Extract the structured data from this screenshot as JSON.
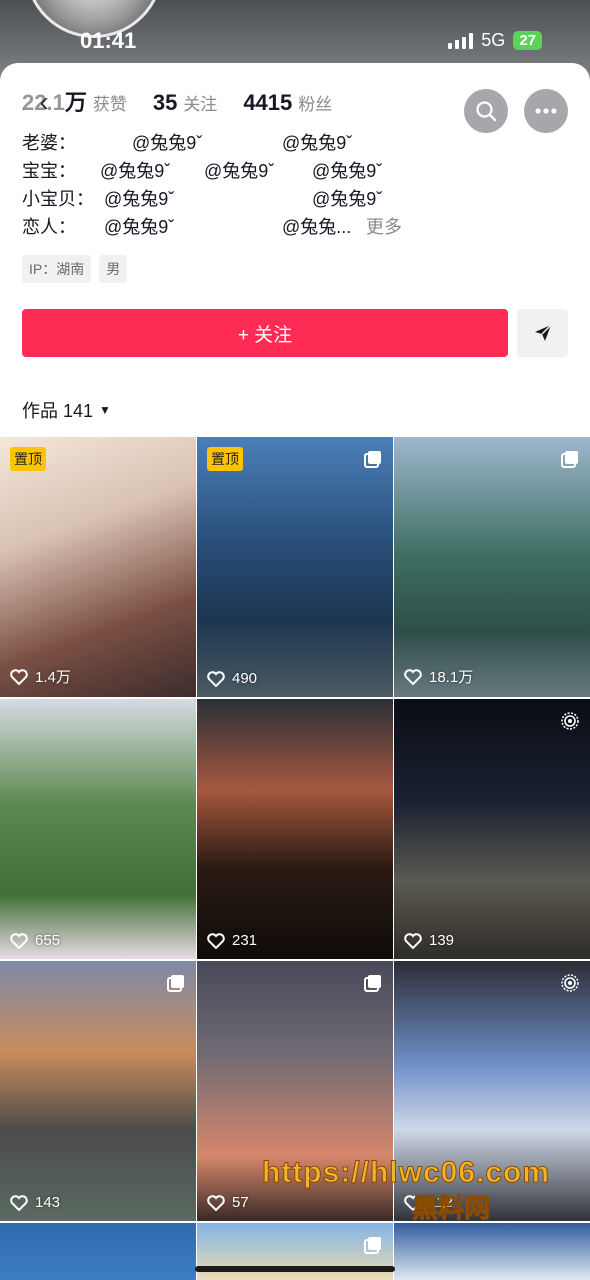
{
  "status": {
    "time": "01:41",
    "network": "5G",
    "battery": "27"
  },
  "profile": {
    "stats": [
      {
        "value": "22.1万",
        "label": "获赞"
      },
      {
        "value": "35",
        "label": "关注"
      },
      {
        "value": "4415",
        "label": "粉丝"
      }
    ],
    "relations": [
      {
        "label": "老婆：",
        "names": [
          "@兔兔9ˇ",
          "@兔兔9ˇ"
        ]
      },
      {
        "label": "宝宝：",
        "names": [
          "@兔兔9ˇ",
          "@兔兔9ˇ",
          "@兔兔9ˇ"
        ]
      },
      {
        "label": "小宝贝：",
        "names": [
          "@兔兔9ˇ",
          "@兔兔9ˇ"
        ]
      },
      {
        "label": "恋人：",
        "names": [
          "@兔兔9ˇ",
          "@兔兔..."
        ],
        "more": "更多"
      }
    ],
    "tags": [
      "IP：湖南",
      "男"
    ],
    "follow_label": "+ 关注",
    "works_label": "作品 141"
  },
  "icons": {
    "back": "back-chevron-icon",
    "search": "search-icon",
    "more": "more-dots-icon",
    "share": "share-arrow-icon",
    "like": "heart-icon",
    "multi": "multi-image-icon",
    "live": "live-photo-icon"
  },
  "colors": {
    "accent": "#fe2c55",
    "pin": "#ffc400"
  },
  "videos": [
    {
      "likes": "1.4万",
      "pinned": "置顶"
    },
    {
      "likes": "490",
      "pinned": "置顶",
      "badge": "multi"
    },
    {
      "likes": "18.1万",
      "badge": "multi"
    },
    {
      "likes": "655"
    },
    {
      "likes": "231"
    },
    {
      "likes": "139",
      "badge": "live"
    },
    {
      "likes": "143",
      "badge": "multi"
    },
    {
      "likes": "57",
      "badge": "multi"
    },
    {
      "likes": "112",
      "badge": "live"
    },
    {},
    {
      "badge": "multi"
    },
    {}
  ],
  "watermark": {
    "url": "https://hlwc06.com",
    "sub": "黑料网"
  }
}
